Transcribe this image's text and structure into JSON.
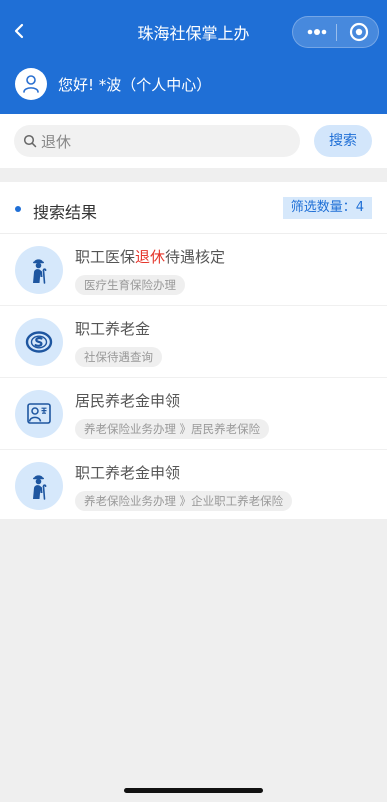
{
  "nav": {
    "title": "珠海社保掌上办",
    "bg_color": "#1f6fd6",
    "back_icon": "chevron-left-icon",
    "more_icon": "more-dots-icon",
    "close_icon": "target-close-icon"
  },
  "user": {
    "greeting": "您好! *波（个人中心）",
    "avatar_icon": "user-icon"
  },
  "search": {
    "value": "退休",
    "button_label": "搜索",
    "icon": "search-icon"
  },
  "results": {
    "header_label": "搜索结果",
    "count_label": "筛选数量：4",
    "accent_color": "#1f6fd6",
    "highlight_color": "#e5372c",
    "items": [
      {
        "title_before": "职工医保",
        "title_highlight": "退休",
        "title_after": "待遇核定",
        "tag": "医疗生育保险办理",
        "icon": "retiree-icon"
      },
      {
        "title_before": "职工养老金",
        "title_highlight": "",
        "title_after": "",
        "tag": "社保待遇查询",
        "icon": "social-security-logo-icon"
      },
      {
        "title_before": "居民养老金申领",
        "title_highlight": "",
        "title_after": "",
        "tag": "养老保险业务办理 》居民养老保险",
        "icon": "insurance-card-icon"
      },
      {
        "title_before": "职工养老金申领",
        "title_highlight": "",
        "title_after": "",
        "tag": "养老保险业务办理 》企业职工养老保险",
        "icon": "retiree-icon"
      }
    ]
  }
}
